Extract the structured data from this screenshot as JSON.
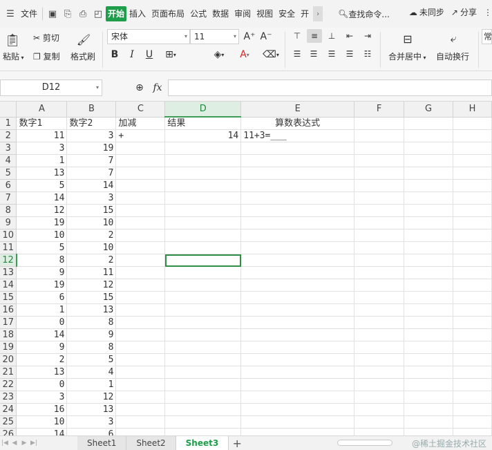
{
  "menubar": {
    "file": "文件",
    "tabs": [
      "开始",
      "插入",
      "页面布局",
      "公式",
      "数据",
      "审阅",
      "视图",
      "安全",
      "开"
    ],
    "active_tab": "开始",
    "search": "查找命令...",
    "sync": "未同步",
    "share": "分享"
  },
  "ribbon": {
    "paste": "粘贴",
    "cut": "剪切",
    "copy": "复制",
    "format_painter": "格式刷",
    "font_name": "宋体",
    "font_size": "11",
    "bold": "B",
    "italic": "I",
    "underline": "U",
    "merge_center": "合并居中",
    "wrap_text": "自动换行",
    "number_format": "常"
  },
  "formula_bar": {
    "name_box": "D12",
    "fx": "fx",
    "formula": ""
  },
  "grid": {
    "columns": [
      "A",
      "B",
      "C",
      "D",
      "E",
      "F",
      "G",
      "H"
    ],
    "selected_column": "D",
    "selected_row": "12",
    "selected_cell": "D12",
    "rows": [
      {
        "n": "1",
        "a": "数字1",
        "b": "数字2",
        "c": "加减",
        "d": "结果",
        "e": "算数表达式"
      },
      {
        "n": "2",
        "a": "11",
        "b": "3",
        "c": "+",
        "d": "14",
        "e": "11+3=___"
      },
      {
        "n": "3",
        "a": "3",
        "b": "19",
        "c": "",
        "d": "",
        "e": ""
      },
      {
        "n": "4",
        "a": "1",
        "b": "7",
        "c": "",
        "d": "",
        "e": ""
      },
      {
        "n": "5",
        "a": "13",
        "b": "7",
        "c": "",
        "d": "",
        "e": ""
      },
      {
        "n": "6",
        "a": "5",
        "b": "14",
        "c": "",
        "d": "",
        "e": ""
      },
      {
        "n": "7",
        "a": "14",
        "b": "3",
        "c": "",
        "d": "",
        "e": ""
      },
      {
        "n": "8",
        "a": "12",
        "b": "15",
        "c": "",
        "d": "",
        "e": ""
      },
      {
        "n": "9",
        "a": "19",
        "b": "10",
        "c": "",
        "d": "",
        "e": ""
      },
      {
        "n": "10",
        "a": "10",
        "b": "2",
        "c": "",
        "d": "",
        "e": ""
      },
      {
        "n": "11",
        "a": "5",
        "b": "10",
        "c": "",
        "d": "",
        "e": ""
      },
      {
        "n": "12",
        "a": "8",
        "b": "2",
        "c": "",
        "d": "",
        "e": ""
      },
      {
        "n": "13",
        "a": "9",
        "b": "11",
        "c": "",
        "d": "",
        "e": ""
      },
      {
        "n": "14",
        "a": "19",
        "b": "12",
        "c": "",
        "d": "",
        "e": ""
      },
      {
        "n": "15",
        "a": "6",
        "b": "15",
        "c": "",
        "d": "",
        "e": ""
      },
      {
        "n": "16",
        "a": "1",
        "b": "13",
        "c": "",
        "d": "",
        "e": ""
      },
      {
        "n": "17",
        "a": "0",
        "b": "8",
        "c": "",
        "d": "",
        "e": ""
      },
      {
        "n": "18",
        "a": "14",
        "b": "9",
        "c": "",
        "d": "",
        "e": ""
      },
      {
        "n": "19",
        "a": "9",
        "b": "8",
        "c": "",
        "d": "",
        "e": ""
      },
      {
        "n": "20",
        "a": "2",
        "b": "5",
        "c": "",
        "d": "",
        "e": ""
      },
      {
        "n": "21",
        "a": "13",
        "b": "4",
        "c": "",
        "d": "",
        "e": ""
      },
      {
        "n": "22",
        "a": "0",
        "b": "1",
        "c": "",
        "d": "",
        "e": ""
      },
      {
        "n": "23",
        "a": "3",
        "b": "12",
        "c": "",
        "d": "",
        "e": ""
      },
      {
        "n": "24",
        "a": "16",
        "b": "13",
        "c": "",
        "d": "",
        "e": ""
      },
      {
        "n": "25",
        "a": "10",
        "b": "3",
        "c": "",
        "d": "",
        "e": ""
      },
      {
        "n": "26",
        "a": "14",
        "b": "6",
        "c": "",
        "d": "",
        "e": ""
      }
    ]
  },
  "sheets": {
    "tabs": [
      "Sheet1",
      "Sheet2",
      "Sheet3"
    ],
    "active": "Sheet3",
    "add": "+"
  },
  "watermark": "@稀土掘金技术社区",
  "colors": {
    "accent": "#1e9e4a",
    "selection": "#2f8d46"
  }
}
